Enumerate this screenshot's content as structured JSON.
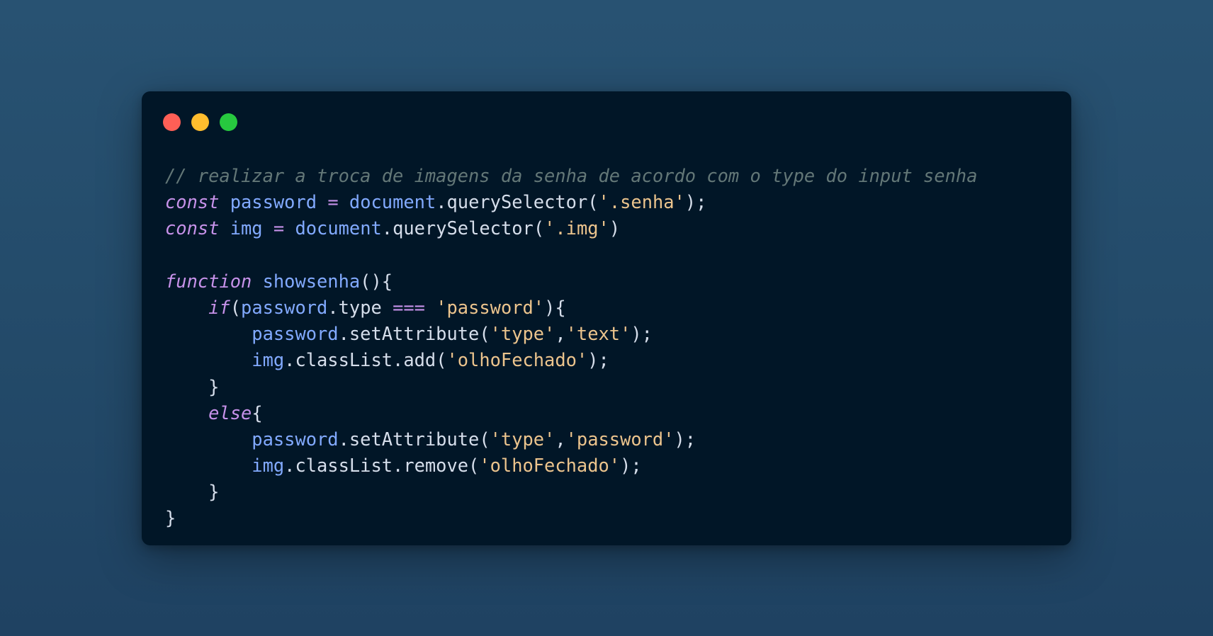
{
  "window": {
    "controls": [
      {
        "name": "close",
        "color": "#ff5f56"
      },
      {
        "name": "minimize",
        "color": "#ffbd2e"
      },
      {
        "name": "zoom",
        "color": "#27c93f"
      }
    ]
  },
  "theme": {
    "page_background": "#285272",
    "editor_background": "#011627",
    "comment": "#637777",
    "keyword": "#c792ea",
    "variable": "#82aaff",
    "string": "#ecc48d",
    "text": "#d6deeb"
  },
  "code": {
    "lines": [
      [
        {
          "t": "// realizar a troca de imagens da senha de acordo com o type do input senha",
          "k": "comment"
        }
      ],
      [
        {
          "t": "const",
          "k": "keyword"
        },
        {
          "t": " ",
          "k": "text"
        },
        {
          "t": "password",
          "k": "var"
        },
        {
          "t": " ",
          "k": "text"
        },
        {
          "t": "=",
          "k": "op"
        },
        {
          "t": " ",
          "k": "text"
        },
        {
          "t": "document",
          "k": "var"
        },
        {
          "t": ".",
          "k": "punct"
        },
        {
          "t": "querySelector",
          "k": "prop"
        },
        {
          "t": "(",
          "k": "punct"
        },
        {
          "t": "'.senha'",
          "k": "string"
        },
        {
          "t": ");",
          "k": "punct"
        }
      ],
      [
        {
          "t": "const",
          "k": "keyword"
        },
        {
          "t": " ",
          "k": "text"
        },
        {
          "t": "img",
          "k": "var"
        },
        {
          "t": " ",
          "k": "text"
        },
        {
          "t": "=",
          "k": "op"
        },
        {
          "t": " ",
          "k": "text"
        },
        {
          "t": "document",
          "k": "var"
        },
        {
          "t": ".",
          "k": "punct"
        },
        {
          "t": "querySelector",
          "k": "prop"
        },
        {
          "t": "(",
          "k": "punct"
        },
        {
          "t": "'.img'",
          "k": "string"
        },
        {
          "t": ")",
          "k": "punct"
        }
      ],
      [],
      [
        {
          "t": "function",
          "k": "keyword"
        },
        {
          "t": " ",
          "k": "text"
        },
        {
          "t": "showsenha",
          "k": "fn"
        },
        {
          "t": "(){",
          "k": "punct"
        }
      ],
      [
        {
          "t": "    ",
          "k": "text"
        },
        {
          "t": "if",
          "k": "keyword"
        },
        {
          "t": "(",
          "k": "punct"
        },
        {
          "t": "password",
          "k": "var"
        },
        {
          "t": ".",
          "k": "punct"
        },
        {
          "t": "type",
          "k": "prop"
        },
        {
          "t": " ",
          "k": "text"
        },
        {
          "t": "===",
          "k": "op"
        },
        {
          "t": " ",
          "k": "text"
        },
        {
          "t": "'password'",
          "k": "string"
        },
        {
          "t": "){",
          "k": "punct"
        }
      ],
      [
        {
          "t": "        ",
          "k": "text"
        },
        {
          "t": "password",
          "k": "var"
        },
        {
          "t": ".",
          "k": "punct"
        },
        {
          "t": "setAttribute",
          "k": "prop"
        },
        {
          "t": "(",
          "k": "punct"
        },
        {
          "t": "'type'",
          "k": "string"
        },
        {
          "t": ",",
          "k": "punct"
        },
        {
          "t": "'text'",
          "k": "string"
        },
        {
          "t": ");",
          "k": "punct"
        }
      ],
      [
        {
          "t": "        ",
          "k": "text"
        },
        {
          "t": "img",
          "k": "var"
        },
        {
          "t": ".",
          "k": "punct"
        },
        {
          "t": "classList",
          "k": "prop"
        },
        {
          "t": ".",
          "k": "punct"
        },
        {
          "t": "add",
          "k": "prop"
        },
        {
          "t": "(",
          "k": "punct"
        },
        {
          "t": "'olhoFechado'",
          "k": "string"
        },
        {
          "t": ");",
          "k": "punct"
        }
      ],
      [
        {
          "t": "    ",
          "k": "text"
        },
        {
          "t": "}",
          "k": "punct"
        }
      ],
      [
        {
          "t": "    ",
          "k": "text"
        },
        {
          "t": "else",
          "k": "keyword"
        },
        {
          "t": "{",
          "k": "punct"
        }
      ],
      [
        {
          "t": "        ",
          "k": "text"
        },
        {
          "t": "password",
          "k": "var"
        },
        {
          "t": ".",
          "k": "punct"
        },
        {
          "t": "setAttribute",
          "k": "prop"
        },
        {
          "t": "(",
          "k": "punct"
        },
        {
          "t": "'type'",
          "k": "string"
        },
        {
          "t": ",",
          "k": "punct"
        },
        {
          "t": "'password'",
          "k": "string"
        },
        {
          "t": ");",
          "k": "punct"
        }
      ],
      [
        {
          "t": "        ",
          "k": "text"
        },
        {
          "t": "img",
          "k": "var"
        },
        {
          "t": ".",
          "k": "punct"
        },
        {
          "t": "classList",
          "k": "prop"
        },
        {
          "t": ".",
          "k": "punct"
        },
        {
          "t": "remove",
          "k": "prop"
        },
        {
          "t": "(",
          "k": "punct"
        },
        {
          "t": "'olhoFechado'",
          "k": "string"
        },
        {
          "t": ");",
          "k": "punct"
        }
      ],
      [
        {
          "t": "    ",
          "k": "text"
        },
        {
          "t": "}",
          "k": "punct"
        }
      ],
      [
        {
          "t": "}",
          "k": "punct"
        }
      ]
    ]
  }
}
